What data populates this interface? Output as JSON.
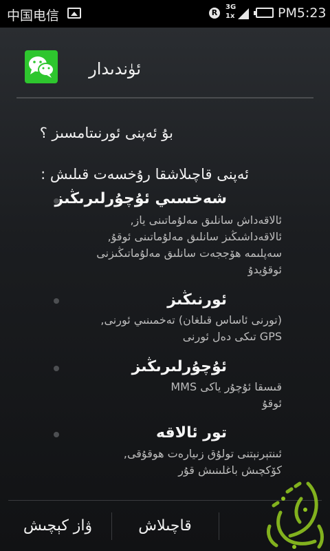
{
  "status_bar": {
    "carrier": "中国电信",
    "network_top": "3G",
    "network_bottom": "1x",
    "time": "PM5:23",
    "r_badge": "R"
  },
  "dialog": {
    "app_name": "ئۈندىدار",
    "question": "بۇ ئەپنى ئورنىتامسىز ؟",
    "allow_heading": "ئەپنى قاچىلاشقا رۇخسەت قىلىش :",
    "permissions": [
      {
        "title": "شەخسىي ئۇچۇرلىرىڭىز",
        "lines": [
          "ئالاقەداش سانلىق مەلۇماتىنى ياز,",
          "ئالاقەداشىڭىز سانلىق مەلۇماتىنى ئوقۇ,",
          "سەپلىمە ھۆججەت سانلىق مەلۇماتىڭىزنى",
          "ئوقۇيدۇ"
        ]
      },
      {
        "title": "ئورنىڭىز",
        "lines": [
          "(تورنى ئاساس قىلغان) تەخمىنىي ئورنى,",
          "GPS تىكى دەل ئورنى"
        ]
      },
      {
        "title": "ئۇچۇرلىرىڭىز",
        "lines": [
          "قىسقا ئۇچۇر ياكى MMS",
          "ئوقۇ"
        ]
      },
      {
        "title": "تور ئالاقە",
        "lines": [
          "ئىنتېرنېتنى تولۇق زىيارەت ھوقۇقى,",
          "كۆكچىش باغلىنىش قۇر"
        ]
      }
    ]
  },
  "buttons": {
    "cancel": "ۋاز كېچىش",
    "install": "قاچىلاش",
    "third": ""
  },
  "colors": {
    "app_icon_bg": "#2ec62e",
    "watermark": "#8fc31f"
  },
  "icons": {
    "app_icon": "wechat-icon",
    "watermark": "uyghur-calligraphy-logo"
  }
}
